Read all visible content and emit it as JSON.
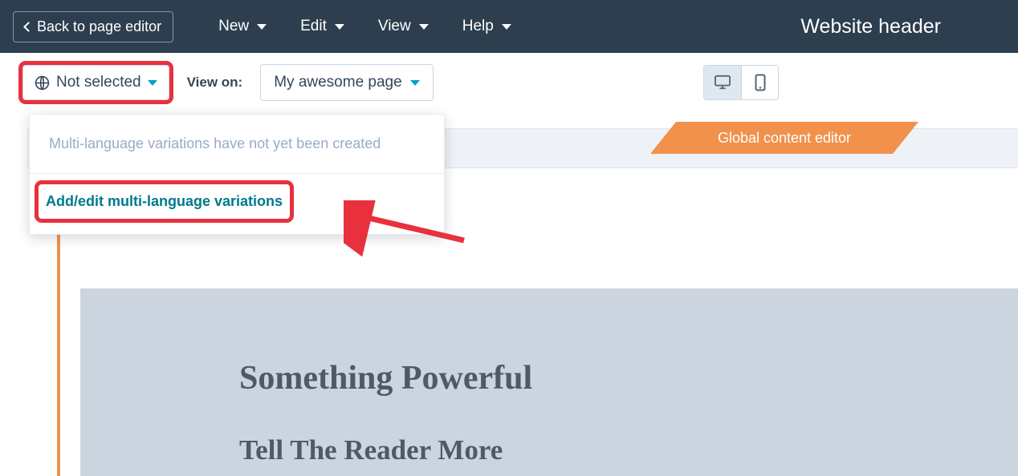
{
  "nav": {
    "back_label": "Back to page editor",
    "items": [
      "New",
      "Edit",
      "View",
      "Help"
    ],
    "title": "Website header"
  },
  "toolbar": {
    "language_label": "Not selected",
    "view_on_label": "View on:",
    "page_label": "My awesome page"
  },
  "dropdown": {
    "message": "Multi-language variations have not yet been created",
    "action_label": "Add/edit multi-language variations"
  },
  "canvas": {
    "global_banner": "Global content editor",
    "heading": "Something Powerful",
    "subheading": "Tell The Reader More"
  },
  "highlight_color": "#e8313c"
}
